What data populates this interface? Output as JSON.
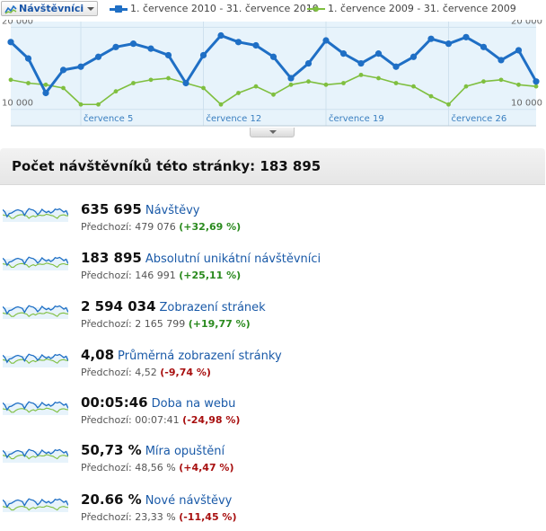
{
  "toolbar": {
    "metric_label": "Návštěvníci",
    "legend_current": "1. července 2010 - 31. července 2010",
    "legend_previous": "1. července 2009 - 31. července 2009"
  },
  "colors": {
    "current": "#1f6fc5",
    "previous": "#7fbf3f",
    "fill": "#e7f3fb",
    "positive": "#2a8a1e",
    "negative": "#a80f0f"
  },
  "chart_data": {
    "type": "line",
    "y_ticks": [
      "20 000",
      "10 000"
    ],
    "ylim": [
      8000,
      20700
    ],
    "x_labels": [
      "července 5",
      "července 12",
      "července 19",
      "července 26"
    ],
    "x_label_days": [
      5,
      12,
      19,
      26
    ],
    "series": [
      {
        "name": "1. července 2010 - 31. července 2010",
        "values": [
          18200,
          16200,
          12000,
          14800,
          15200,
          16400,
          17600,
          18000,
          17400,
          16600,
          13200,
          16600,
          19000,
          18200,
          17800,
          16400,
          13800,
          15600,
          18400,
          16800,
          15600,
          16800,
          15200,
          16400,
          18600,
          18000,
          18800,
          17600,
          16000,
          17200,
          13400
        ]
      },
      {
        "name": "1. července 2009 - 31. července 2009",
        "values": [
          13600,
          13200,
          13000,
          12600,
          10600,
          10600,
          12200,
          13200,
          13600,
          13800,
          13200,
          12600,
          10600,
          12000,
          12800,
          11800,
          13000,
          13400,
          13000,
          13200,
          14200,
          13800,
          13200,
          12800,
          11600,
          10600,
          12800,
          13400,
          13600,
          13000,
          12800
        ]
      }
    ]
  },
  "header": {
    "title": "Počet návštěvníků této stránky: 183 895"
  },
  "metrics": [
    {
      "value": "635 695",
      "name": "Návštěvy",
      "prev_label": "Předchozí:",
      "prev_value": "479 076",
      "delta": "(+32,69 %)",
      "trend": "positive"
    },
    {
      "value": "183 895",
      "name": "Absolutní unikátní návštěvníci",
      "prev_label": "Předchozí:",
      "prev_value": "146 991",
      "delta": "(+25,11 %)",
      "trend": "positive"
    },
    {
      "value": "2 594 034",
      "name": "Zobrazení stránek",
      "prev_label": "Předchozí:",
      "prev_value": "2 165 799",
      "delta": "(+19,77 %)",
      "trend": "positive"
    },
    {
      "value": "4,08",
      "name": "Průměrná zobrazení stránky",
      "prev_label": "Předchozí:",
      "prev_value": "4,52",
      "delta": "(-9,74 %)",
      "trend": "negative"
    },
    {
      "value": "00:05:46",
      "name": "Doba na webu",
      "prev_label": "Předchozí:",
      "prev_value": "00:07:41",
      "delta": "(-24,98 %)",
      "trend": "negative"
    },
    {
      "value": "50,73 %",
      "name": "Míra opuštění",
      "prev_label": "Předchozí:",
      "prev_value": "48,56 %",
      "delta": "(+4,47 %)",
      "trend": "negative"
    },
    {
      "value": "20.66 %",
      "name": "Nové návštěvy",
      "prev_label": "Předchozí:",
      "prev_value": "23,33 %",
      "delta": "(-11,45 %)",
      "trend": "negative"
    }
  ]
}
